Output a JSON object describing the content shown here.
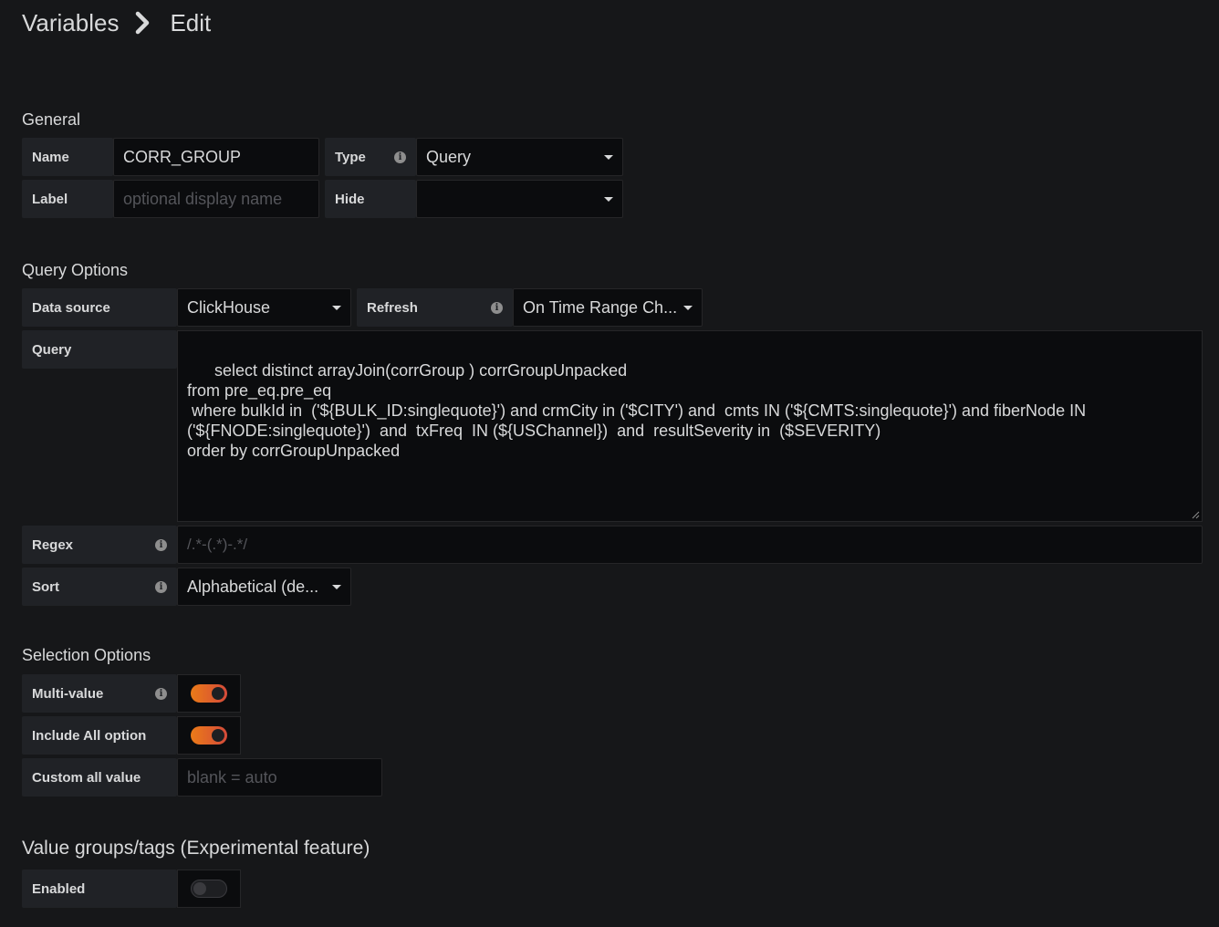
{
  "breadcrumb": {
    "parent": "Variables",
    "current": "Edit"
  },
  "general": {
    "title": "General",
    "name_label": "Name",
    "name_value": "CORR_GROUP",
    "type_label": "Type",
    "type_value": "Query",
    "label_label": "Label",
    "label_placeholder": "optional display name",
    "hide_label": "Hide",
    "hide_value": ""
  },
  "query_options": {
    "title": "Query Options",
    "datasource_label": "Data source",
    "datasource_value": "ClickHouse",
    "refresh_label": "Refresh",
    "refresh_value": "On Time Range Ch...",
    "query_label": "Query",
    "query_value": "select distinct arrayJoin(corrGroup ) corrGroupUnpacked\nfrom pre_eq.pre_eq\n where bulkId in  ('${BULK_ID:singlequote}') and crmCity in ('$CITY') and  cmts IN ('${CMTS:singlequote}') and fiberNode IN\n('${FNODE:singlequote}')  and  txFreq  IN (${USChannel})  and  resultSeverity in  ($SEVERITY)\norder by corrGroupUnpacked",
    "regex_label": "Regex",
    "regex_placeholder": "/.*-(.*)-.*/",
    "sort_label": "Sort",
    "sort_value": "Alphabetical (de..."
  },
  "selection_options": {
    "title": "Selection Options",
    "multi_value_label": "Multi-value",
    "multi_value_on": true,
    "include_all_label": "Include All option",
    "include_all_on": true,
    "custom_all_label": "Custom all value",
    "custom_all_placeholder": "blank = auto"
  },
  "value_groups": {
    "title": "Value groups/tags (Experimental feature)",
    "enabled_label": "Enabled",
    "enabled_on": false
  },
  "colors": {
    "accent_start": "#eb7b18",
    "accent_end": "#d44a3a",
    "background": "#161719"
  }
}
